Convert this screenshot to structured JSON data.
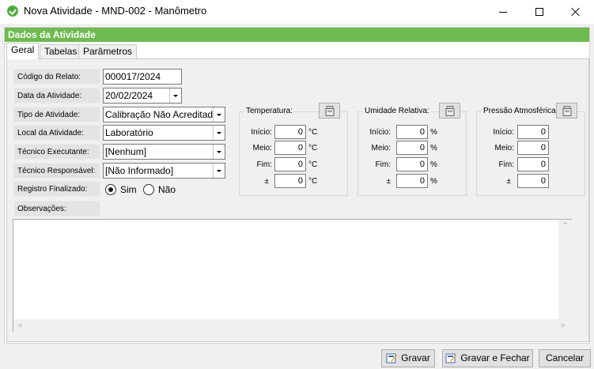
{
  "window": {
    "title": "Nova Atividade - MND-002 - Manômetro"
  },
  "section_header": "Dados da Atividade",
  "tabs": [
    {
      "label": "Geral",
      "active": true
    },
    {
      "label": "Tabelas",
      "active": false
    },
    {
      "label": "Parâmetros",
      "active": false
    }
  ],
  "form": {
    "codigo_relato": {
      "label": "Código do Relato:",
      "value": "000017/2024"
    },
    "data_atividade": {
      "label": "Data da Atividade:",
      "value": "20/02/2024"
    },
    "tipo_atividade": {
      "label": "Tipo de Atividade:",
      "value": "Calibração Não Acreditada"
    },
    "local_atividade": {
      "label": "Local da Atividade:",
      "value": "Laboratório"
    },
    "tecnico_executante": {
      "label": "Técnico Executante:",
      "value": "[Nenhum]"
    },
    "tecnico_responsavel": {
      "label": "Técnico Responsável:",
      "value": "[Não Informado]"
    },
    "registro_finalizado": {
      "label": "Registro Finalizado:",
      "option_sim": "Sim",
      "option_nao": "Não",
      "selected": "Sim"
    },
    "observacoes": {
      "label": "Observações:",
      "value": ""
    }
  },
  "environment_groups": [
    {
      "title": "Temperatura:",
      "unit": "°C",
      "rows": [
        {
          "label": "Início:",
          "value": "0"
        },
        {
          "label": "Meio:",
          "value": "0"
        },
        {
          "label": "Fim:",
          "value": "0"
        },
        {
          "label": "±",
          "value": "0"
        }
      ],
      "icon": "instrument-icon"
    },
    {
      "title": "Umidade Relativa:",
      "unit": "%",
      "rows": [
        {
          "label": "Início:",
          "value": "0"
        },
        {
          "label": "Meio:",
          "value": "0"
        },
        {
          "label": "Fim:",
          "value": "0"
        },
        {
          "label": "±",
          "value": "0"
        }
      ],
      "icon": "instrument-icon"
    },
    {
      "title": "Pressão Atmosférica:",
      "unit": "",
      "rows": [
        {
          "label": "Início:",
          "value": "0"
        },
        {
          "label": "Meio:",
          "value": "0"
        },
        {
          "label": "Fim:",
          "value": "0"
        },
        {
          "label": "±",
          "value": "0"
        }
      ],
      "icon": "instrument-icon"
    }
  ],
  "buttons": {
    "gravar": "Gravar",
    "gravar_fechar": "Gravar e Fechar",
    "cancelar": "Cancelar"
  },
  "colors": {
    "header_green": "#6dbb4e",
    "app_icon_green": "#4caf3b"
  }
}
